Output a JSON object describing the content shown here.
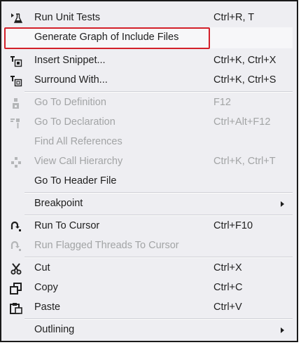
{
  "menu": {
    "items": [
      {
        "label": "Run Unit Tests",
        "shortcut": "Ctrl+R, T",
        "icon": "flask-icon"
      },
      {
        "label": "Generate Graph of Include Files",
        "shortcut": "",
        "icon": ""
      },
      {
        "label": "Insert Snippet...",
        "shortcut": "Ctrl+K, Ctrl+X",
        "icon": "insert-snippet-icon"
      },
      {
        "label": "Surround With...",
        "shortcut": "Ctrl+K, Ctrl+S",
        "icon": "surround-with-icon"
      },
      {
        "label": "Go To Definition",
        "shortcut": "F12",
        "icon": "go-to-definition-icon"
      },
      {
        "label": "Go To Declaration",
        "shortcut": "Ctrl+Alt+F12",
        "icon": "go-to-declaration-icon"
      },
      {
        "label": "Find All References",
        "shortcut": "",
        "icon": ""
      },
      {
        "label": "View Call Hierarchy",
        "shortcut": "Ctrl+K, Ctrl+T",
        "icon": "call-hierarchy-icon"
      },
      {
        "label": "Go To Header File",
        "shortcut": "",
        "icon": ""
      },
      {
        "label": "Breakpoint",
        "shortcut": "",
        "icon": ""
      },
      {
        "label": "Run To Cursor",
        "shortcut": "Ctrl+F10",
        "icon": "run-to-cursor-icon"
      },
      {
        "label": "Run Flagged Threads To Cursor",
        "shortcut": "",
        "icon": "run-flagged-threads-icon"
      },
      {
        "label": "Cut",
        "shortcut": "Ctrl+X",
        "icon": "scissors-icon"
      },
      {
        "label": "Copy",
        "shortcut": "Ctrl+C",
        "icon": "copy-icon"
      },
      {
        "label": "Paste",
        "shortcut": "Ctrl+V",
        "icon": "paste-icon"
      },
      {
        "label": "Outlining",
        "shortcut": "",
        "icon": ""
      }
    ]
  },
  "colors": {
    "menu_background": "#eeeef2",
    "text": "#1e1e1e",
    "disabled_text": "#a2a4a5",
    "highlight_outline": "#d3202a"
  }
}
